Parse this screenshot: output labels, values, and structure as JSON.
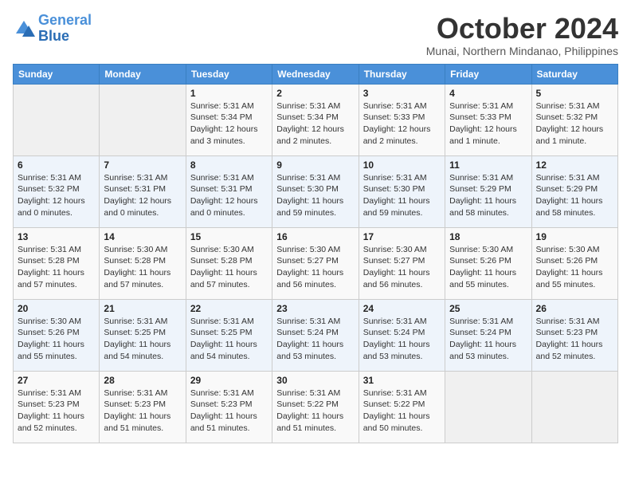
{
  "header": {
    "logo_line1": "General",
    "logo_line2": "Blue",
    "month": "October 2024",
    "location": "Munai, Northern Mindanao, Philippines"
  },
  "weekdays": [
    "Sunday",
    "Monday",
    "Tuesday",
    "Wednesday",
    "Thursday",
    "Friday",
    "Saturday"
  ],
  "weeks": [
    [
      {
        "day": "",
        "info": ""
      },
      {
        "day": "",
        "info": ""
      },
      {
        "day": "1",
        "info": "Sunrise: 5:31 AM\nSunset: 5:34 PM\nDaylight: 12 hours and 3 minutes."
      },
      {
        "day": "2",
        "info": "Sunrise: 5:31 AM\nSunset: 5:34 PM\nDaylight: 12 hours and 2 minutes."
      },
      {
        "day": "3",
        "info": "Sunrise: 5:31 AM\nSunset: 5:33 PM\nDaylight: 12 hours and 2 minutes."
      },
      {
        "day": "4",
        "info": "Sunrise: 5:31 AM\nSunset: 5:33 PM\nDaylight: 12 hours and 1 minute."
      },
      {
        "day": "5",
        "info": "Sunrise: 5:31 AM\nSunset: 5:32 PM\nDaylight: 12 hours and 1 minute."
      }
    ],
    [
      {
        "day": "6",
        "info": "Sunrise: 5:31 AM\nSunset: 5:32 PM\nDaylight: 12 hours and 0 minutes."
      },
      {
        "day": "7",
        "info": "Sunrise: 5:31 AM\nSunset: 5:31 PM\nDaylight: 12 hours and 0 minutes."
      },
      {
        "day": "8",
        "info": "Sunrise: 5:31 AM\nSunset: 5:31 PM\nDaylight: 12 hours and 0 minutes."
      },
      {
        "day": "9",
        "info": "Sunrise: 5:31 AM\nSunset: 5:30 PM\nDaylight: 11 hours and 59 minutes."
      },
      {
        "day": "10",
        "info": "Sunrise: 5:31 AM\nSunset: 5:30 PM\nDaylight: 11 hours and 59 minutes."
      },
      {
        "day": "11",
        "info": "Sunrise: 5:31 AM\nSunset: 5:29 PM\nDaylight: 11 hours and 58 minutes."
      },
      {
        "day": "12",
        "info": "Sunrise: 5:31 AM\nSunset: 5:29 PM\nDaylight: 11 hours and 58 minutes."
      }
    ],
    [
      {
        "day": "13",
        "info": "Sunrise: 5:31 AM\nSunset: 5:28 PM\nDaylight: 11 hours and 57 minutes."
      },
      {
        "day": "14",
        "info": "Sunrise: 5:30 AM\nSunset: 5:28 PM\nDaylight: 11 hours and 57 minutes."
      },
      {
        "day": "15",
        "info": "Sunrise: 5:30 AM\nSunset: 5:28 PM\nDaylight: 11 hours and 57 minutes."
      },
      {
        "day": "16",
        "info": "Sunrise: 5:30 AM\nSunset: 5:27 PM\nDaylight: 11 hours and 56 minutes."
      },
      {
        "day": "17",
        "info": "Sunrise: 5:30 AM\nSunset: 5:27 PM\nDaylight: 11 hours and 56 minutes."
      },
      {
        "day": "18",
        "info": "Sunrise: 5:30 AM\nSunset: 5:26 PM\nDaylight: 11 hours and 55 minutes."
      },
      {
        "day": "19",
        "info": "Sunrise: 5:30 AM\nSunset: 5:26 PM\nDaylight: 11 hours and 55 minutes."
      }
    ],
    [
      {
        "day": "20",
        "info": "Sunrise: 5:30 AM\nSunset: 5:26 PM\nDaylight: 11 hours and 55 minutes."
      },
      {
        "day": "21",
        "info": "Sunrise: 5:31 AM\nSunset: 5:25 PM\nDaylight: 11 hours and 54 minutes."
      },
      {
        "day": "22",
        "info": "Sunrise: 5:31 AM\nSunset: 5:25 PM\nDaylight: 11 hours and 54 minutes."
      },
      {
        "day": "23",
        "info": "Sunrise: 5:31 AM\nSunset: 5:24 PM\nDaylight: 11 hours and 53 minutes."
      },
      {
        "day": "24",
        "info": "Sunrise: 5:31 AM\nSunset: 5:24 PM\nDaylight: 11 hours and 53 minutes."
      },
      {
        "day": "25",
        "info": "Sunrise: 5:31 AM\nSunset: 5:24 PM\nDaylight: 11 hours and 53 minutes."
      },
      {
        "day": "26",
        "info": "Sunrise: 5:31 AM\nSunset: 5:23 PM\nDaylight: 11 hours and 52 minutes."
      }
    ],
    [
      {
        "day": "27",
        "info": "Sunrise: 5:31 AM\nSunset: 5:23 PM\nDaylight: 11 hours and 52 minutes."
      },
      {
        "day": "28",
        "info": "Sunrise: 5:31 AM\nSunset: 5:23 PM\nDaylight: 11 hours and 51 minutes."
      },
      {
        "day": "29",
        "info": "Sunrise: 5:31 AM\nSunset: 5:23 PM\nDaylight: 11 hours and 51 minutes."
      },
      {
        "day": "30",
        "info": "Sunrise: 5:31 AM\nSunset: 5:22 PM\nDaylight: 11 hours and 51 minutes."
      },
      {
        "day": "31",
        "info": "Sunrise: 5:31 AM\nSunset: 5:22 PM\nDaylight: 11 hours and 50 minutes."
      },
      {
        "day": "",
        "info": ""
      },
      {
        "day": "",
        "info": ""
      }
    ]
  ]
}
